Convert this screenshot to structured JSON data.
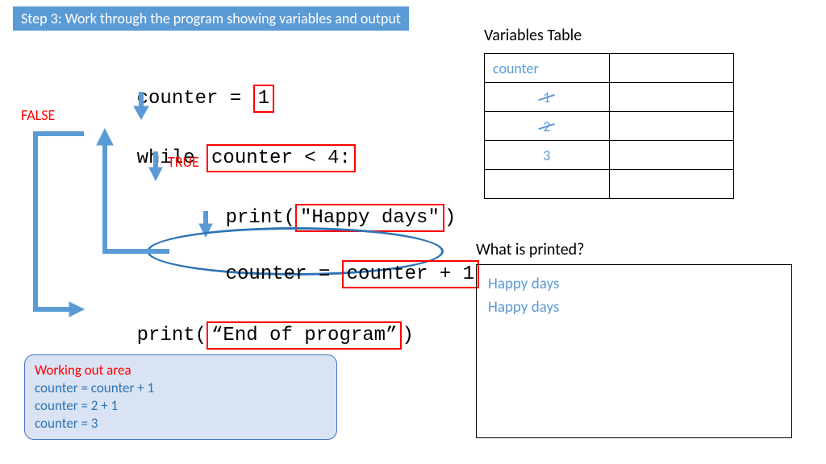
{
  "header": "Step 3: Work through the program showing variables and output",
  "code": {
    "line1_pre": "counter = ",
    "line1_box": "1",
    "line2_pre": "while ",
    "line2_box": "counter < 4:",
    "line3_pre": "print(",
    "line3_box": "\"Happy days\"",
    "line3_post": ")",
    "line4_pre": "counter = ",
    "line4_box": "counter + 1",
    "line5_pre": "print(",
    "line5_box": "“End of program”",
    "line5_post": ")"
  },
  "labels": {
    "false": "FALSE",
    "true": "TRUE"
  },
  "vars_title": "Variables Table",
  "vars_table": {
    "header": "counter",
    "rows": [
      "1",
      "2",
      "3",
      ""
    ]
  },
  "printed_title": "What is printed?",
  "printed_lines": [
    "Happy days",
    "Happy days"
  ],
  "working": {
    "title": "Working out area",
    "lines": [
      "counter = counter + 1",
      "counter = 2 + 1",
      "counter = 3"
    ]
  }
}
